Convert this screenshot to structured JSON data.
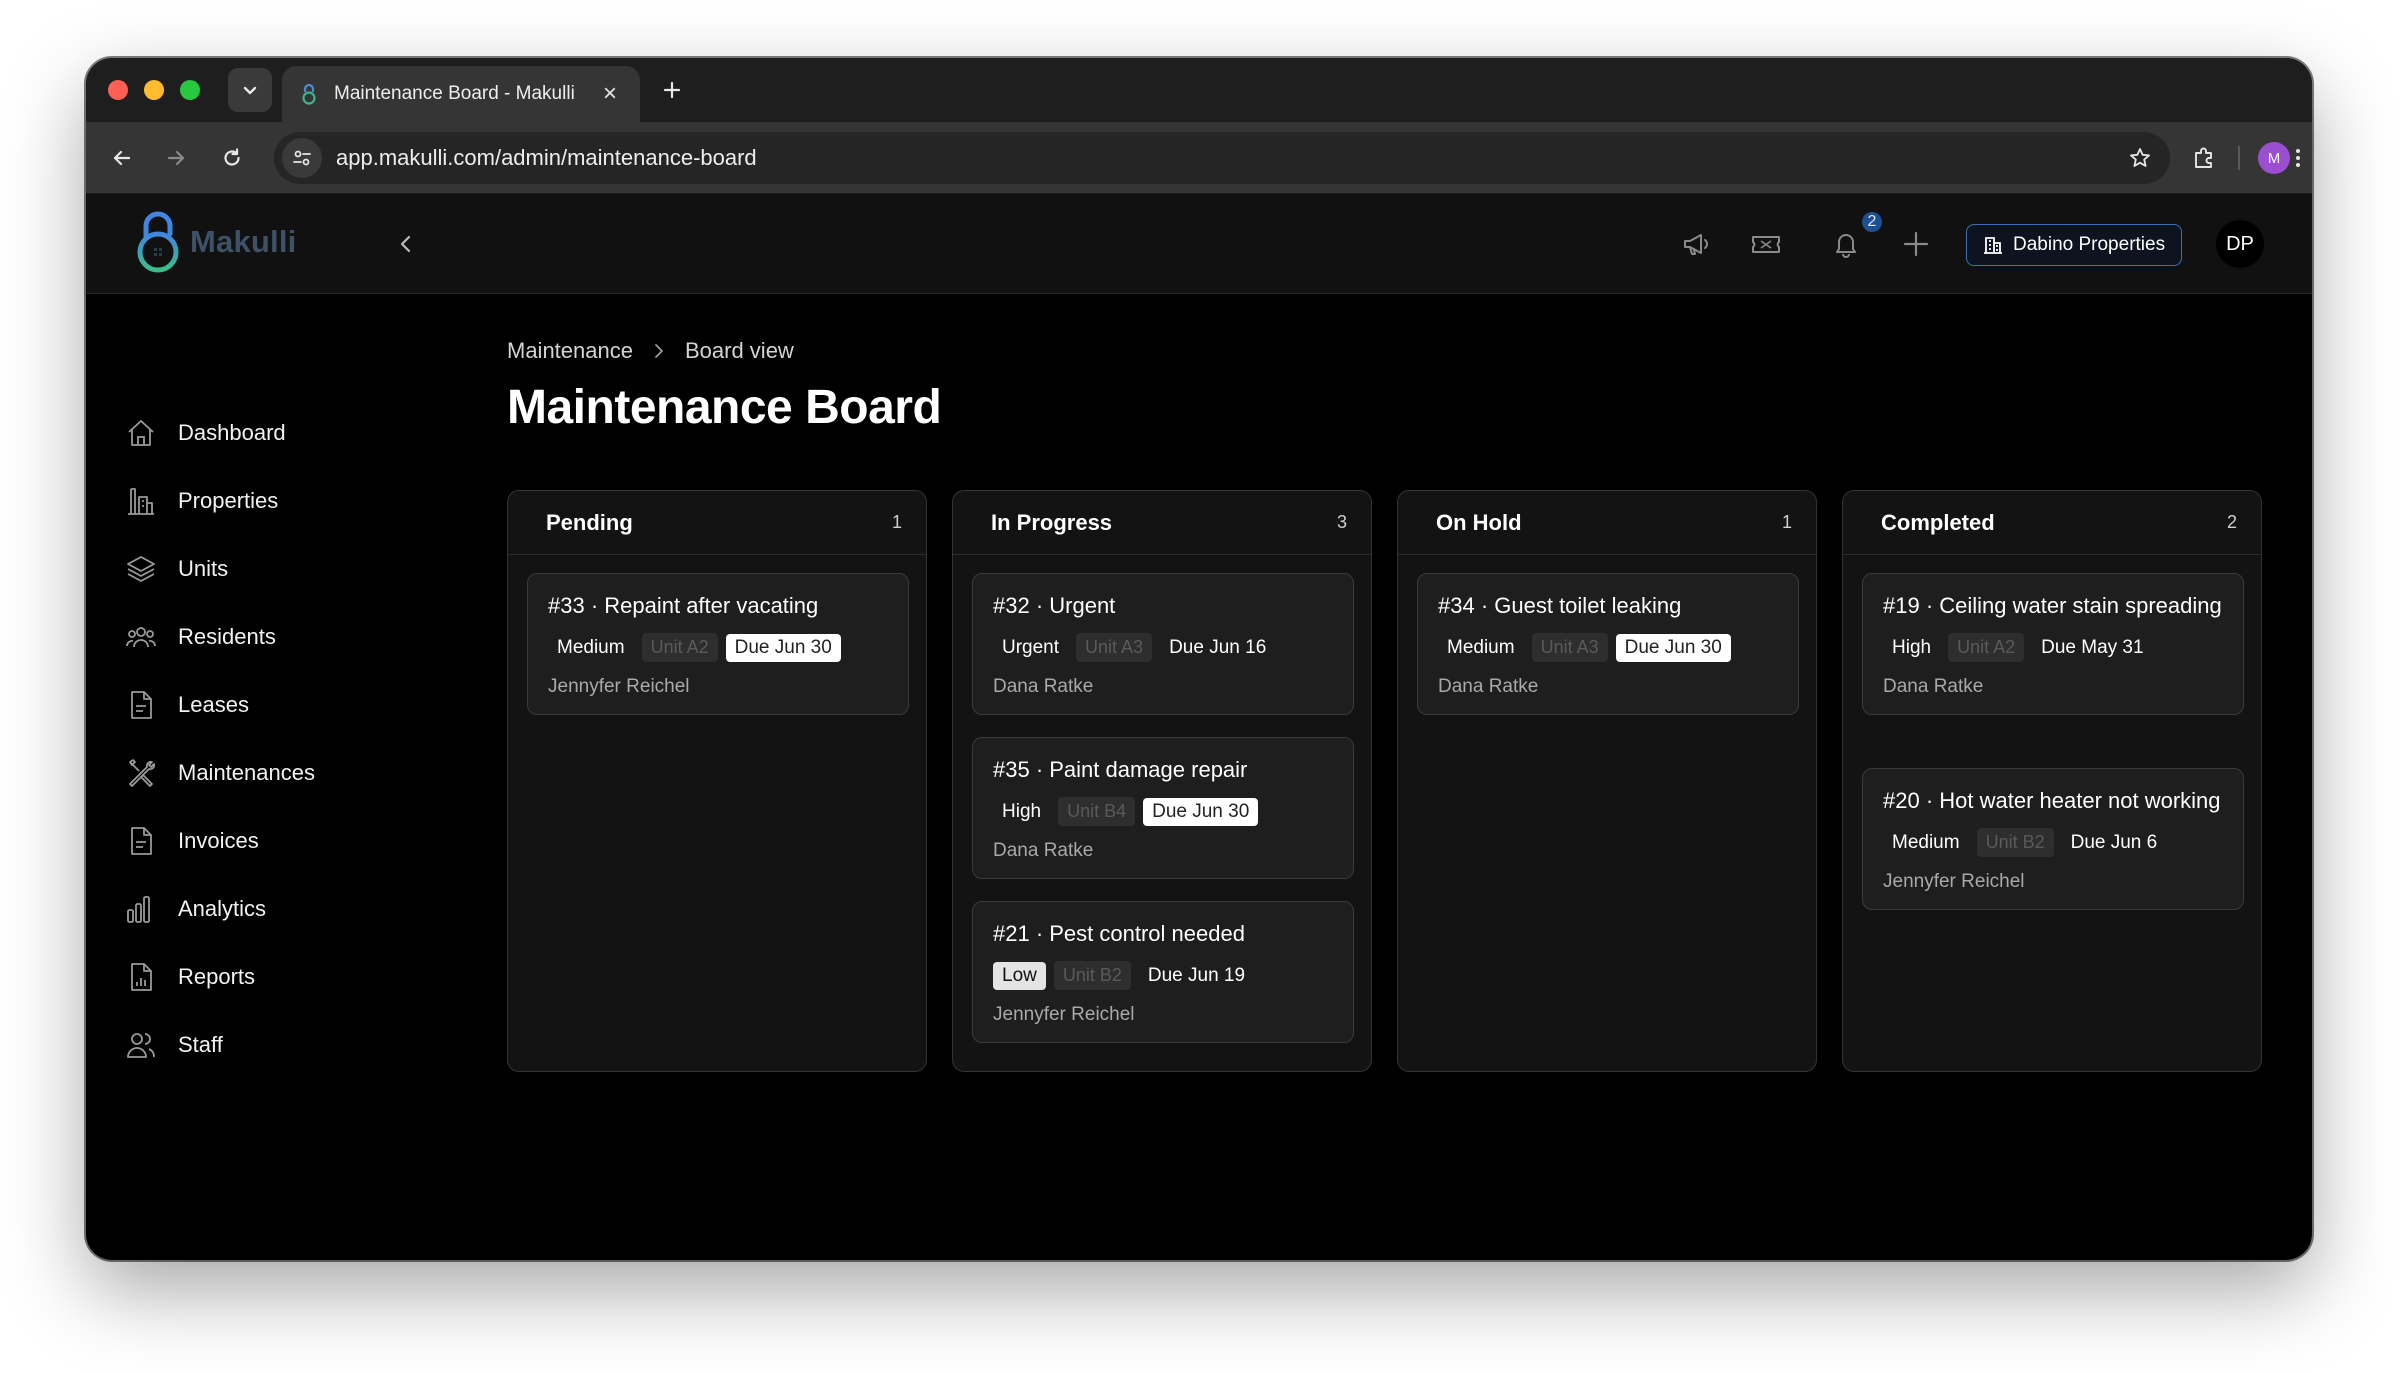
{
  "browser": {
    "tab_title": "Maintenance Board - Makulli",
    "url": "app.makulli.com/admin/maintenance-board",
    "profile_initial": "M"
  },
  "header": {
    "logo_text": "Makulli",
    "notification_count": "2",
    "org_name": "Dabino Properties",
    "user_initials": "DP"
  },
  "sidebar": {
    "items": [
      {
        "label": "Dashboard",
        "icon": "home-icon"
      },
      {
        "label": "Properties",
        "icon": "building-icon"
      },
      {
        "label": "Units",
        "icon": "layers-icon"
      },
      {
        "label": "Residents",
        "icon": "users-icon"
      },
      {
        "label": "Leases",
        "icon": "document-icon"
      },
      {
        "label": "Maintenances",
        "icon": "tools-icon"
      },
      {
        "label": "Invoices",
        "icon": "document-icon"
      },
      {
        "label": "Analytics",
        "icon": "bar-chart-icon"
      },
      {
        "label": "Reports",
        "icon": "report-icon"
      },
      {
        "label": "Staff",
        "icon": "staff-icon"
      }
    ]
  },
  "breadcrumb": {
    "parent": "Maintenance",
    "current": "Board view"
  },
  "page_title": "Maintenance Board",
  "columns": [
    {
      "title": "Pending",
      "count": "1",
      "cards": [
        {
          "title": "#33 · Repaint after vacating",
          "priority": "Medium",
          "unit": "Unit A2",
          "due": "Due Jun 30",
          "assignee": "Jennyfer Reichel"
        }
      ]
    },
    {
      "title": "In Progress",
      "count": "3",
      "cards": [
        {
          "title": "#32 · Urgent",
          "priority": "Urgent",
          "unit": "Unit A3",
          "due": "Due Jun 16",
          "assignee": "Dana Ratke"
        },
        {
          "title": "#35 · Paint damage repair",
          "priority": "High",
          "unit": "Unit B4",
          "due": "Due Jun 30",
          "assignee": "Dana Ratke"
        },
        {
          "title": "#21 · Pest control needed",
          "priority": "Low",
          "unit": "Unit B2",
          "due": "Due Jun 19",
          "assignee": "Jennyfer Reichel"
        }
      ]
    },
    {
      "title": "On Hold",
      "count": "1",
      "cards": [
        {
          "title": "#34 · Guest toilet leaking",
          "priority": "Medium",
          "unit": "Unit A3",
          "due": "Due Jun 30",
          "assignee": "Dana Ratke"
        }
      ]
    },
    {
      "title": "Completed",
      "count": "2",
      "cards": [
        {
          "title": "#19 · Ceiling water stain spreading",
          "priority": "High",
          "unit": "Unit A2",
          "due": "Due May 31",
          "assignee": "Dana Ratke"
        },
        {
          "title": "#20 · Hot water heater not working",
          "priority": "Medium",
          "unit": "Unit B2",
          "due": "Due Jun 6",
          "assignee": "Jennyfer Reichel"
        }
      ]
    }
  ],
  "colors": {
    "accent": "#3b6fb6",
    "badge": "#1d4f91",
    "background": "#000000",
    "card": "#1e1e1e"
  }
}
